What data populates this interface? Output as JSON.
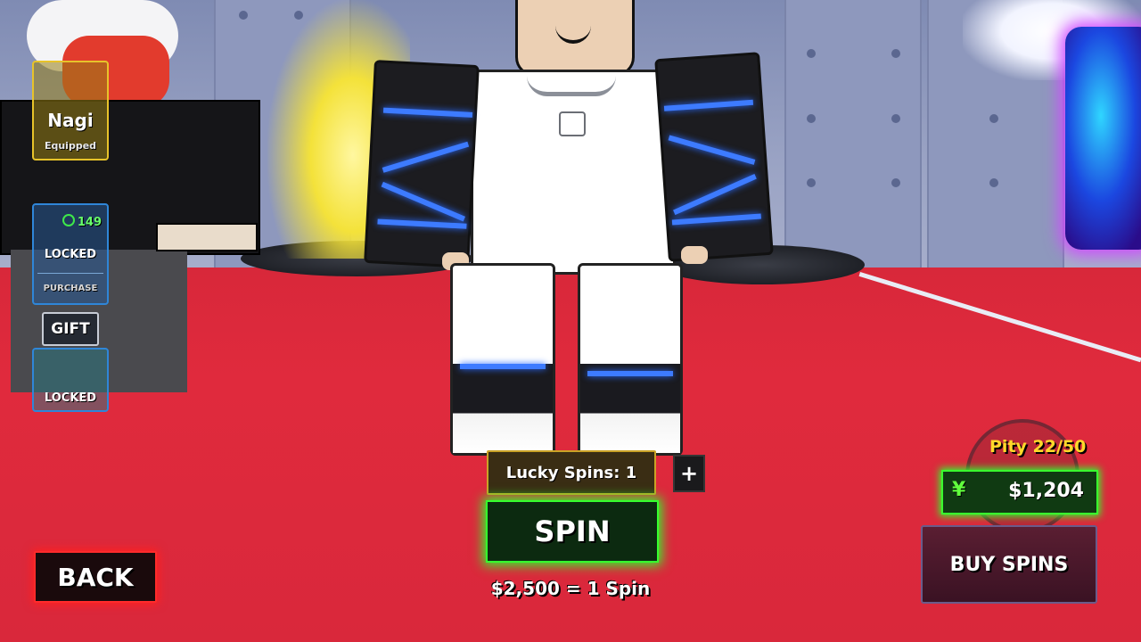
{
  "sidebar": {
    "equipped_card": {
      "name": "Nagi",
      "status": "Equipped"
    },
    "locked_card_1": {
      "price": "149",
      "status": "LOCKED",
      "action": "PURCHASE"
    },
    "gift_button": "GIFT",
    "locked_card_2": {
      "status": "LOCKED"
    }
  },
  "spin_panel": {
    "lucky_spins": "Lucky Spins: 1",
    "plus_icon": "+",
    "spin_button": "SPIN",
    "spin_price": "$2,500 = 1 Spin"
  },
  "currency_panel": {
    "pity": "Pity 22/50",
    "currency_icon": "¥",
    "cash": "$1,204",
    "buy_button": "BUY SPINS"
  },
  "back_button": "BACK",
  "colors": {
    "floor": "#e02a3d",
    "spin_glow": "#2cff2c",
    "back_glow": "#ff2020",
    "pity_text": "#ffd92a",
    "gold_border": "#e7c32a",
    "blue_border": "#2f86d8"
  }
}
